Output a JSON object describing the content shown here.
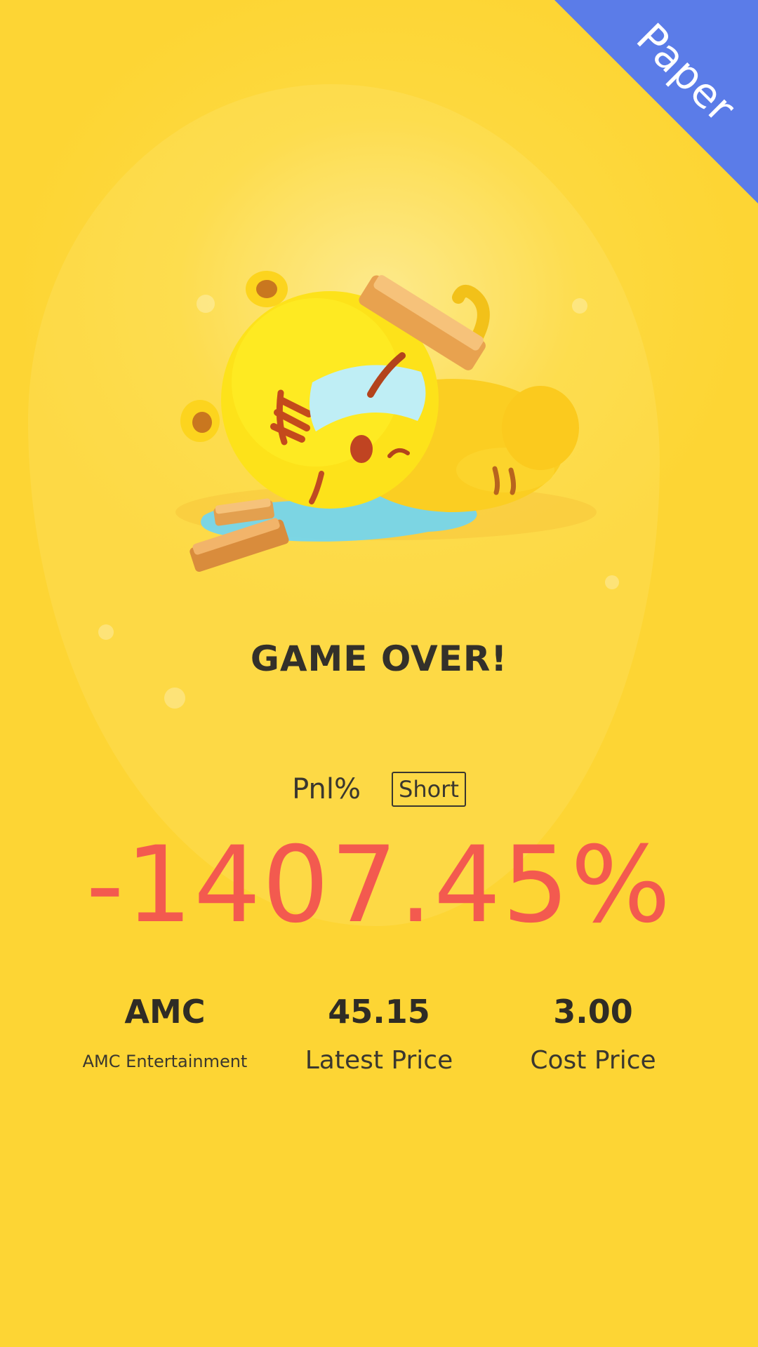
{
  "corner_ribbon": {
    "label": "Paper",
    "color": "#5b7ce8"
  },
  "illustration": {
    "description_icon": "sad-tiger-mascot-icon"
  },
  "result": {
    "title": "GAME OVER!",
    "pnl_label": "Pnl%",
    "position_badge": "Short",
    "pnl_value": "-1407.45%",
    "pnl_color": "#f35a4f"
  },
  "stats": {
    "symbol": "AMC",
    "company_name": "AMC Entertainment",
    "latest_price_value": "45.15",
    "latest_price_label": "Latest Price",
    "cost_price_value": "3.00",
    "cost_price_label": "Cost Price"
  },
  "colors": {
    "background": "#fdd534",
    "text_dark": "#33302a"
  }
}
